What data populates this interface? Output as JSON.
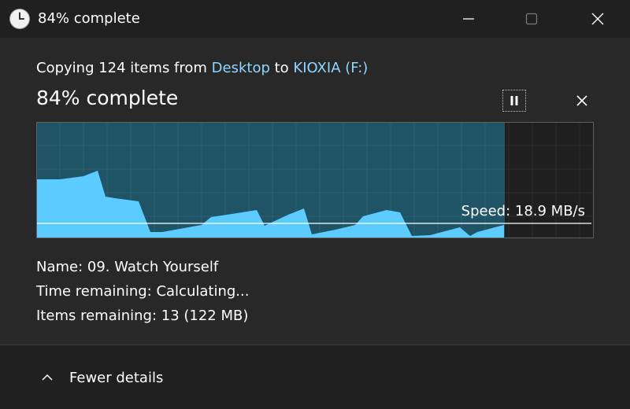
{
  "window": {
    "title": "84% complete",
    "icon": "clock-icon"
  },
  "operation": {
    "copy_prefix": "Copying 124 items from ",
    "source": "Desktop",
    "connector": " to ",
    "destination": "KIOXIA (F:)",
    "status": "84% complete",
    "progress_fraction": 0.84,
    "speed_label": "Speed: 18.9 MB/s"
  },
  "details": {
    "name": "Name: 09. Watch Yourself",
    "time_remaining": "Time remaining: Calculating...",
    "items_remaining": "Items remaining: 13 (122 MB)"
  },
  "footer": {
    "toggle_label": "Fewer details"
  },
  "colors": {
    "accent_link": "#8fd6ff",
    "graph_fill": "#5ccbff",
    "graph_progress_bg": "#1f5466"
  }
}
